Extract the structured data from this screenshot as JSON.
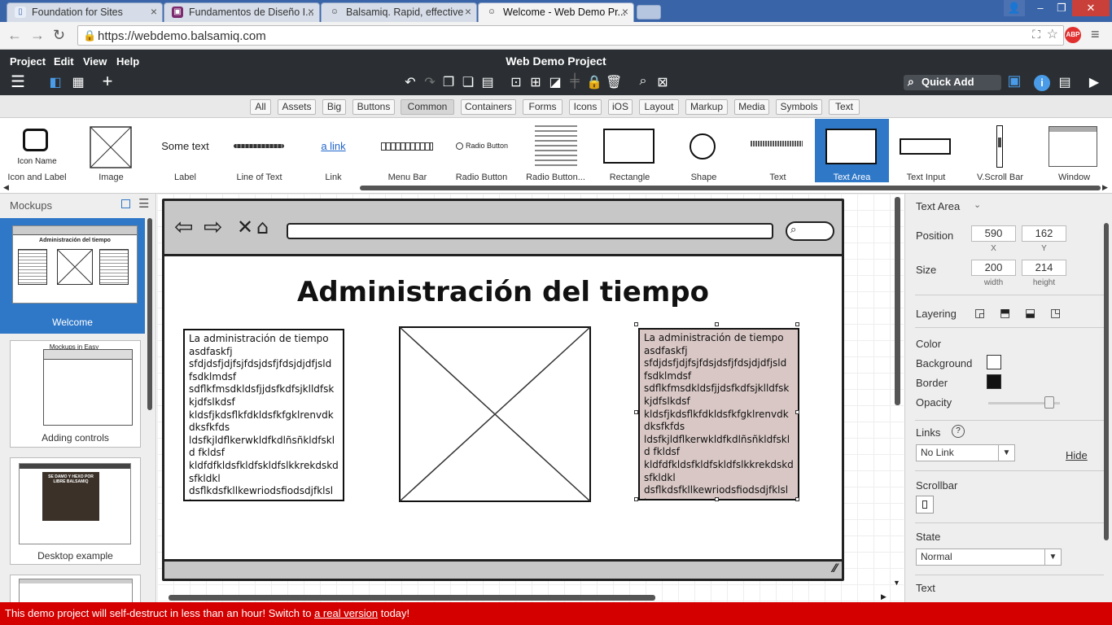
{
  "tabs": [
    {
      "title": "Foundation for Sites",
      "active": false
    },
    {
      "title": "Fundamentos de Diseño I...",
      "active": false
    },
    {
      "title": "Balsamiq. Rapid, effective",
      "active": false
    },
    {
      "title": "Welcome - Web Demo Pr...",
      "active": true
    }
  ],
  "address": {
    "url": "https://webdemo.balsamiq.com"
  },
  "app": {
    "menus": [
      "Project",
      "Edit",
      "View",
      "Help"
    ],
    "title": "Web Demo Project",
    "quick_add": "Quick Add"
  },
  "filters": [
    "All",
    "Assets",
    "Big",
    "Buttons",
    "Common",
    "Containers",
    "Forms",
    "Icons",
    "iOS",
    "Layout",
    "Markup",
    "Media",
    "Symbols",
    "Text"
  ],
  "filter_selected": "Common",
  "library": [
    {
      "label": "Icon and Label",
      "preview": "Icon Name"
    },
    {
      "label": "Image"
    },
    {
      "label": "Label",
      "preview": "Some text"
    },
    {
      "label": "Line of Text"
    },
    {
      "label": "Link",
      "preview": "a link"
    },
    {
      "label": "Menu Bar"
    },
    {
      "label": "Radio Button",
      "preview": "Radio Button"
    },
    {
      "label": "Radio Button..."
    },
    {
      "label": "Rectangle"
    },
    {
      "label": "Shape"
    },
    {
      "label": "Text"
    },
    {
      "label": "Text Area",
      "selected": true
    },
    {
      "label": "Text Input"
    },
    {
      "label": "V.Scroll Bar"
    },
    {
      "label": "Window"
    }
  ],
  "mockups": {
    "header": "Mockups",
    "items": [
      {
        "label": "Welcome",
        "selected": true,
        "thumb_title": "Administración del tiempo"
      },
      {
        "label": "Adding controls",
        "thumb_title": "Mockups in Easy"
      },
      {
        "label": "Desktop example",
        "thumb_title": "SE DAMO Y HEXO POR LIBRE BALSAMIQ"
      }
    ]
  },
  "canvas": {
    "heading": "Administración del tiempo",
    "textarea_left": "La administración de tiempo asdfaskfj sfdjdsfjdjfsjfdsjdsfjfdsjdjdfjsld fsdklmdsf sdflkfmsdkldsfjjdsfkdfsjklldfsk kjdfslkdsf kldsfjkdsflkfdkldsfkfgklrenvdk dksfkfds ldsfkjldflkerwkldfkdlñsñkldfskld fkldsf kldfdfkldsfkldfskldfslkkrekdskd sfkldkl dsflkdsfkllkewriodsfiodsdjfklslk",
    "textarea_right": "La administración de tiempo asdfaskfj sfdjdsfjdjfsjfdsjdsfjfdsjdjdfjsld fsdklmdsf sdflkfmsdkldsfjjdsfkdfsjklldfsk kjdfslkdsf kldsfjkdsflkfdkldsfkfgklrenvdk dksfkfds ldsfkjldflkerwkldfkdlñsñkldfskld fkldsf kldfdfkldsfkldfskldfslkkrekdskd sfkldkl dsflkdsfkllkewriodsfiodsdjfklslk"
  },
  "properties": {
    "title": "Text Area",
    "position_label": "Position",
    "x": "590",
    "y": "162",
    "x_sub": "X",
    "y_sub": "Y",
    "size_label": "Size",
    "width": "200",
    "height": "214",
    "w_sub": "width",
    "h_sub": "height",
    "layering": "Layering",
    "color": "Color",
    "background": "Background",
    "border": "Border",
    "opacity": "Opacity",
    "opacity_value": 0.85,
    "links": "Links",
    "link_value": "No Link",
    "hide": "Hide",
    "scrollbar": "Scrollbar",
    "state": "State",
    "state_value": "Normal",
    "text": "Text"
  },
  "banner": {
    "pre": "This demo project will self-destruct in less than an hour! Switch to ",
    "link": "a real version",
    "post": " today!"
  },
  "colors": {
    "accent": "#2f78c8",
    "banner": "#d40000",
    "toolbar": "#2b2f33",
    "selected_fill": "#d8c7c4"
  }
}
